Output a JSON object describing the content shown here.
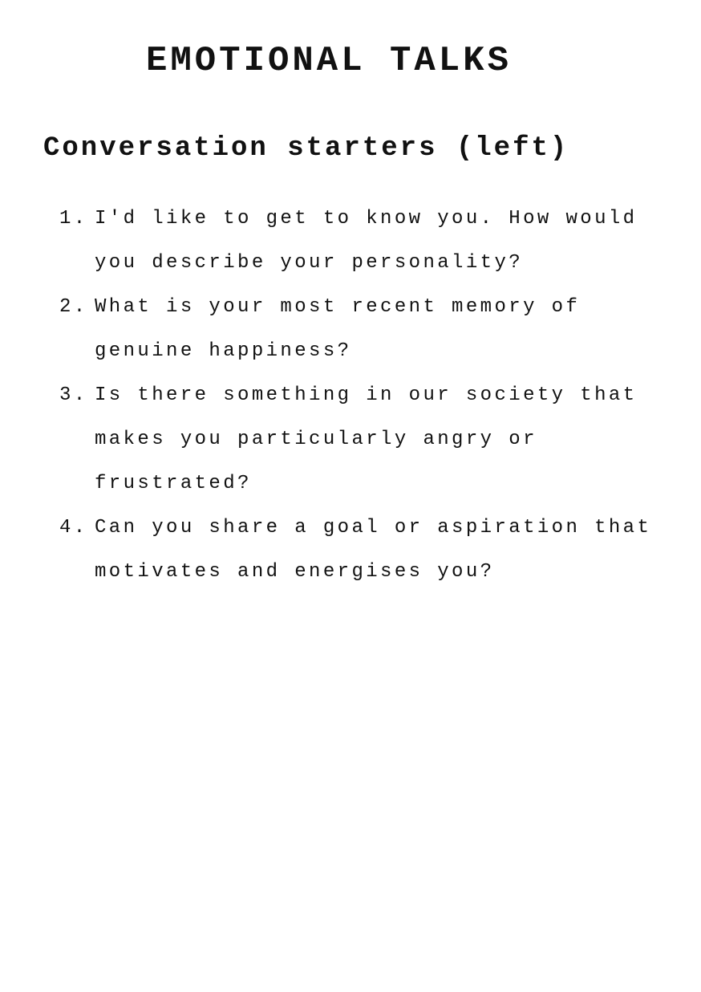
{
  "document": {
    "title": "EMOTIONAL TALKS",
    "subtitle": "Conversation starters (left)",
    "items": [
      {
        "number": "1.",
        "text": "I'd like to get to know you. How would you describe your personality?"
      },
      {
        "number": "2.",
        "text": "What is your most recent memory of genuine happiness?"
      },
      {
        "number": "3.",
        "text": "Is there something in our society that makes you particularly angry or frustrated?"
      },
      {
        "number": "4.",
        "text": "Can you share a goal or aspiration that motivates and energises you?"
      }
    ]
  }
}
